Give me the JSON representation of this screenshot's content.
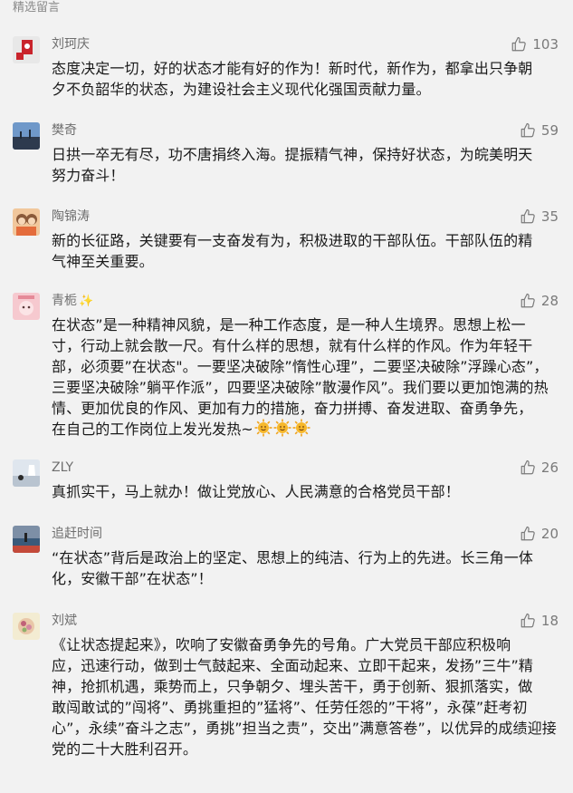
{
  "section_title": "精选留言",
  "comments": [
    {
      "name": "刘珂庆",
      "likes": "103",
      "text": "态度决定一切，好的状态才能有好的作为！新时代，新作为，都拿出只争朝\n夕不负韶华的状态，为建设社会主义现代化强国贡献力量。"
    },
    {
      "name": "樊奇",
      "likes": "59",
      "text": "日拱一卒无有尽，功不唐捐终入海。提振精气神，保持好状态，为皖美明天\n努力奋斗！"
    },
    {
      "name": "陶锦涛",
      "likes": "35",
      "text": "新的长征路，关键要有一支奋发有为，积极进取的干部队伍。干部队伍的精\n气神至关重要。"
    },
    {
      "name": "青栀",
      "badge": "✨",
      "likes": "28",
      "text": "在状态”是一种精神风貌，是一种工作态度，是一种人生境界。思想上松一\n寸，行动上就会散一尺。有什么样的思想，就有什么样的作风。作为年轻干\n部，必须要”在状态\"。一要坚决破除”惰性心理”，二要坚决破除”浮躁心态”，\n三要坚决破除”躺平作派”，四要坚决破除”散漫作风”。我们要以更加饱满的热\n情、更加优良的作风、更加有力的措施，奋力拼搏、奋发进取、奋勇争先，\n在自己的工作岗位上发光发热~",
      "emoji_count": 3
    },
    {
      "name": "ZLY",
      "likes": "26",
      "text": "真抓实干，马上就办！做让党放心、人民满意的合格党员干部！"
    },
    {
      "name": "追赶时间",
      "likes": "20",
      "text": "“在状态”背后是政治上的坚定、思想上的纯洁、行为上的先进。长三角一体\n化，安徽干部”在状态”！"
    },
    {
      "name": "刘斌",
      "likes": "18",
      "text": "《让状态提起来》，吹响了安徽奋勇争先的号角。广大党员干部应积极响\n应，迅速行动，做到士气鼓起来、全面动起来、立即干起来，发扬”三牛”精\n神，抢抓机遇，乘势而上，只争朝夕、埋头苦干，勇于创新、狠抓落实，做\n敢闯敢试的”闯将”、勇挑重担的”猛将”、任劳任怨的”干将”，永葆”赶考初\n心”，永续”奋斗之志”，勇挑”担当之责”，交出”满意答卷”，以优异的成绩迎接\n党的二十大胜利召开。"
    }
  ],
  "icons": {
    "like": "thumbs-up-icon",
    "emoji": "sun-face-icon"
  },
  "colors": {
    "background": "#f2f2f2",
    "meta_text": "#6e6e6e",
    "body_text": "#1a1a1a"
  }
}
